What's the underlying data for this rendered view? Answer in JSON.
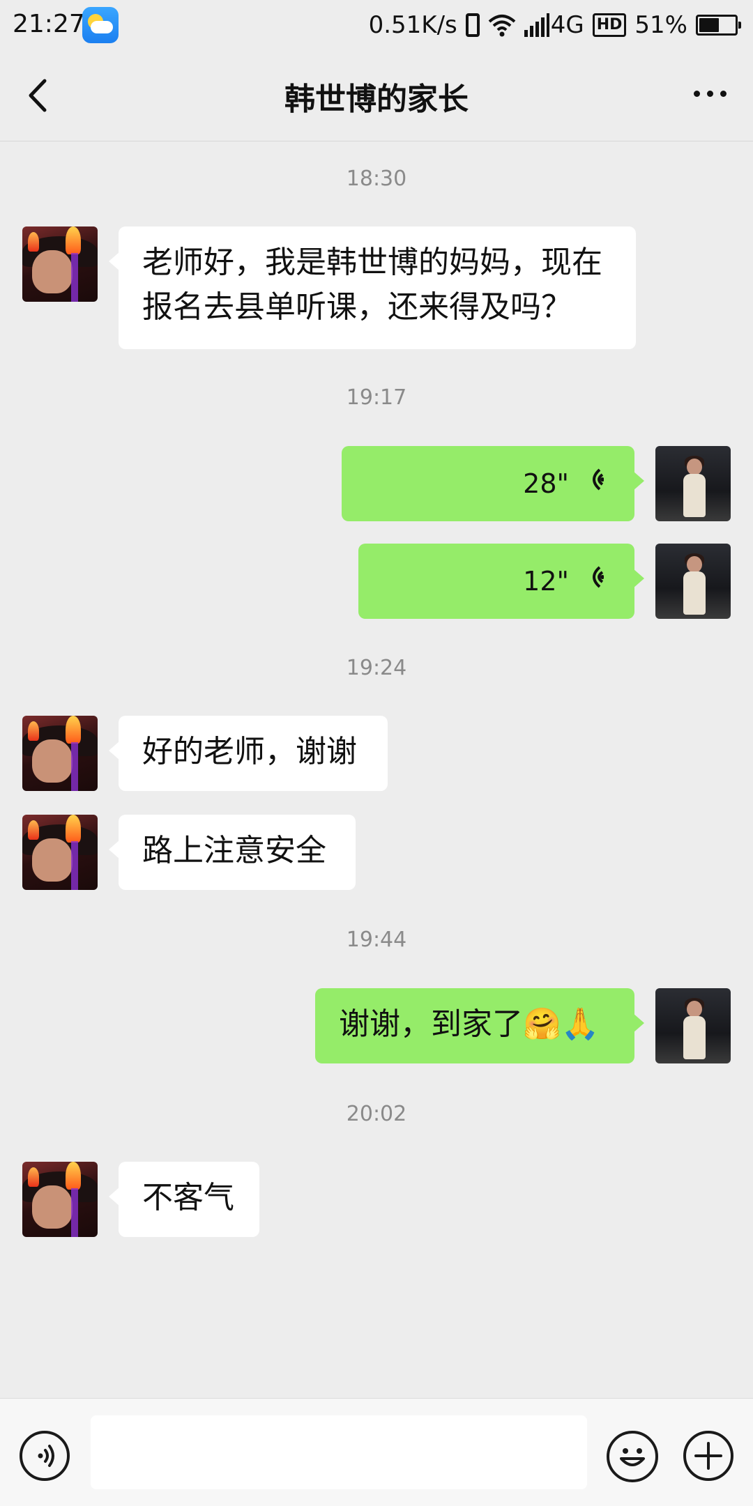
{
  "status_bar": {
    "time": "21:27",
    "weather_icon": "weather-partly-cloudy-icon",
    "net_speed": "0.51K/s",
    "network": "4G",
    "hd": "HD",
    "battery_percent": "51%",
    "battery_level": 0.51
  },
  "nav": {
    "title": "韩世博的家长",
    "back_icon": "chevron-left-icon",
    "more_icon": "more-horizontal-icon"
  },
  "messages": {
    "ts1": "18:30",
    "m1": "老师好，我是韩世博的妈妈，现在报名去县单听课，还来得及吗？",
    "ts2": "19:17",
    "voice1": "28\"",
    "voice2": "12\"",
    "ts3": "19:24",
    "m2": "好的老师，谢谢",
    "m3": "路上注意安全",
    "ts4": "19:44",
    "m4": "谢谢，到家了🤗🙏",
    "ts5": "20:02",
    "m5": "不客气"
  },
  "input_bar": {
    "voice_icon": "voice-input-icon",
    "emoji_icon": "emoji-icon",
    "plus_icon": "plus-icon",
    "text_value": ""
  },
  "colors": {
    "bg": "#ededed",
    "self_bubble": "#95ec69",
    "other_bubble": "#ffffff",
    "timestamp": "#8a8a8a"
  }
}
